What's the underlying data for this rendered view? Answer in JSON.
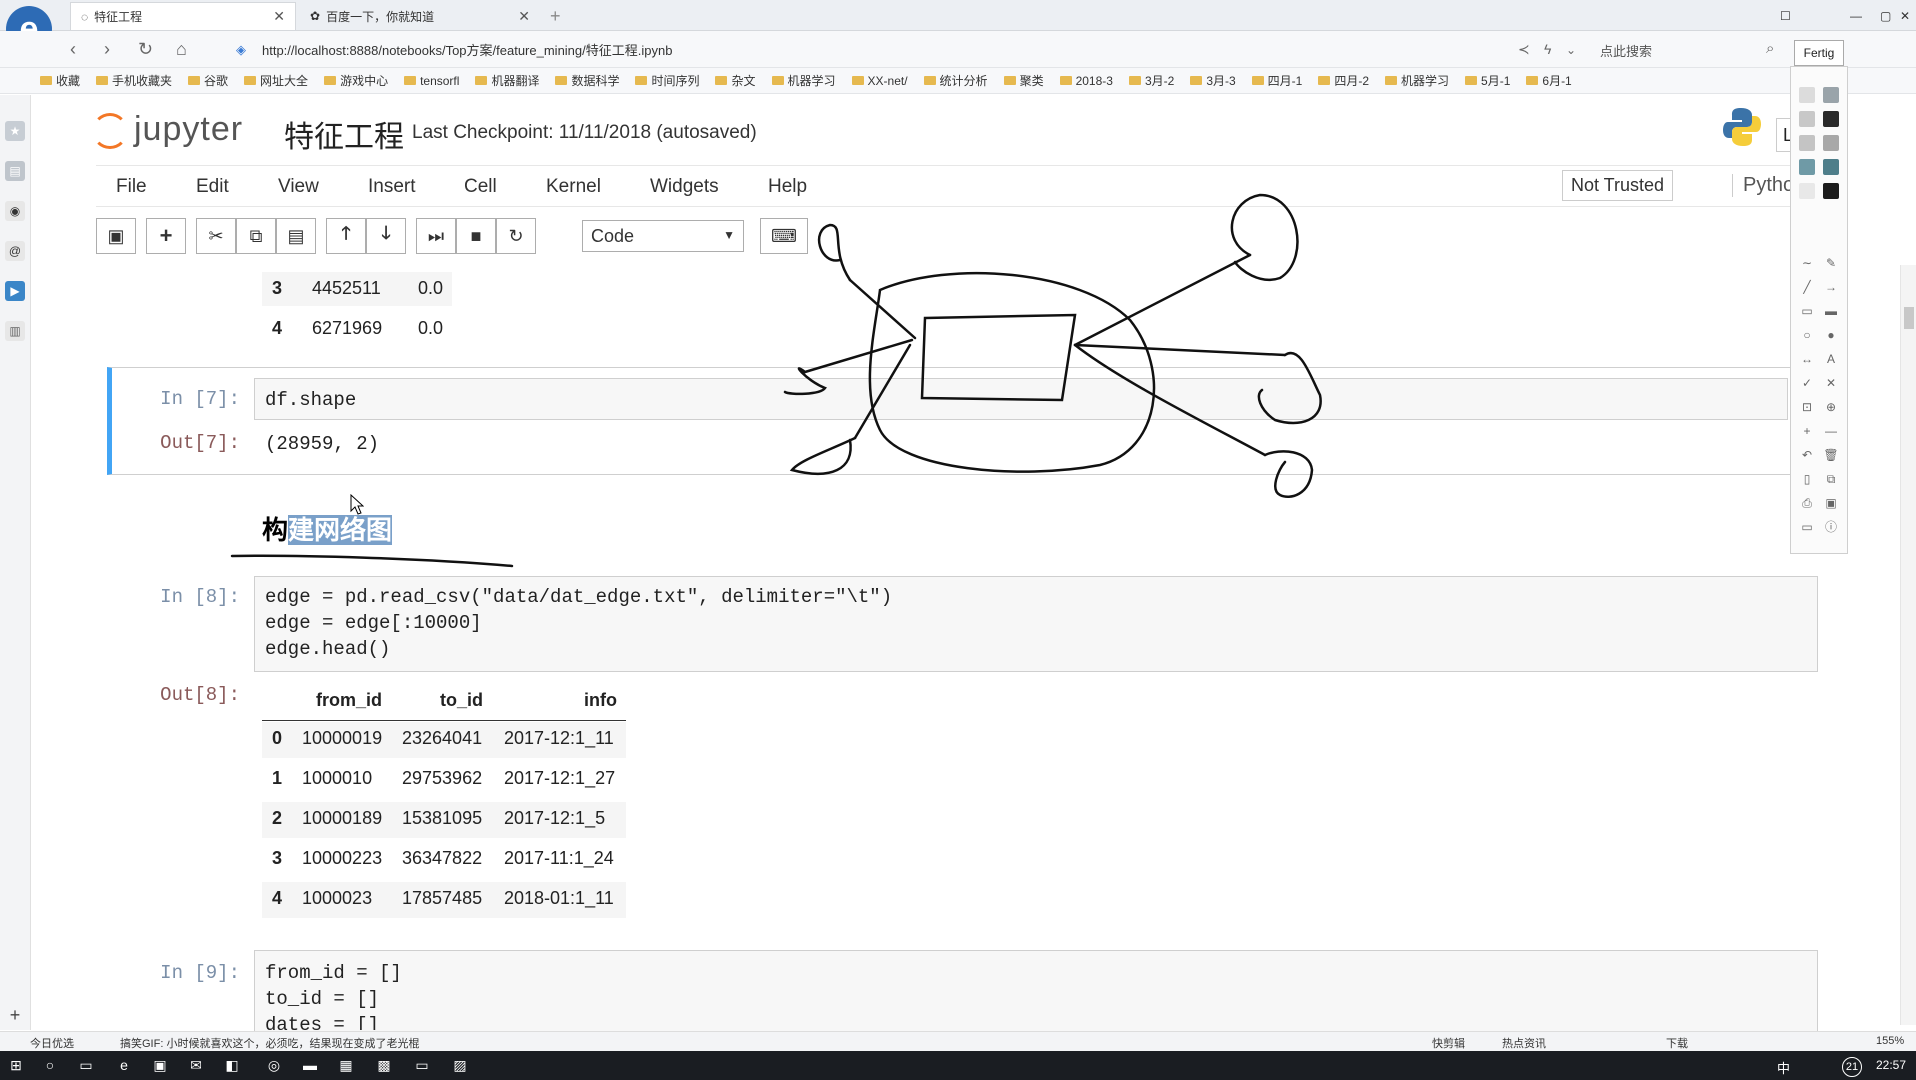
{
  "browser": {
    "tabs": [
      {
        "label": "特征工程",
        "active": true
      },
      {
        "label": "百度一下，你就知道",
        "active": false
      }
    ],
    "url": "http://localhost:8888/notebooks/Top方案/feature_mining/特征工程.ipynb",
    "search_hint": "点此搜索",
    "bookmarks": [
      "收藏",
      "手机收藏夹",
      "谷歌",
      "网址大全",
      "游戏中心",
      "tensorfl",
      "机器翻译",
      "数据科学",
      "时间序列",
      "杂文",
      "机器学习",
      "XX-net/",
      "统计分析",
      "聚类",
      "2018-3",
      "3月-2",
      "3月-3",
      "四月-1",
      "四月-2",
      "机器学习",
      "5月-1",
      "6月-1"
    ]
  },
  "jupyter": {
    "logo_text": "jupyter",
    "notebook_title": "特征工程",
    "checkpoint": "Last Checkpoint: 11/11/2018 (autosaved)",
    "menu": [
      "File",
      "Edit",
      "View",
      "Insert",
      "Cell",
      "Kernel",
      "Widgets",
      "Help"
    ],
    "trusted": "Not Trusted",
    "kernel": "Pytho",
    "cell_type": "Code"
  },
  "top_table_rows": [
    {
      "idx": "3",
      "a": "4452511",
      "b": "0.0"
    },
    {
      "idx": "4",
      "a": "6271969",
      "b": "0.0"
    }
  ],
  "cell7": {
    "prompt_in": "In [7]:",
    "code": "df.shape",
    "prompt_out": "Out[7]:",
    "output": "(28959, 2)"
  },
  "heading": {
    "pre": "构",
    "highlighted": "建网络图"
  },
  "cell8": {
    "prompt_in": "In [8]:",
    "code_lines": [
      "edge = pd.read_csv(\"data/dat_edge.txt\", delimiter=\"\\t\")",
      "edge = edge[:10000]",
      "edge.head()"
    ],
    "prompt_out": "Out[8]:",
    "columns": [
      "from_id",
      "to_id",
      "info"
    ],
    "rows": [
      {
        "idx": "0",
        "from_id": "10000019",
        "to_id": "23264041",
        "info": "2017-12:1_11"
      },
      {
        "idx": "1",
        "from_id": "1000010",
        "to_id": "29753962",
        "info": "2017-12:1_27"
      },
      {
        "idx": "2",
        "from_id": "10000189",
        "to_id": "15381095",
        "info": "2017-12:1_5"
      },
      {
        "idx": "3",
        "from_id": "10000223",
        "to_id": "36347822",
        "info": "2017-11:1_24"
      },
      {
        "idx": "4",
        "from_id": "1000023",
        "to_id": "17857485",
        "info": "2018-01:1_11"
      }
    ]
  },
  "cell9": {
    "prompt_in": "In [9]:",
    "code_lines": [
      "from_id = []",
      "to_id = []",
      "dates = []"
    ]
  },
  "palette": {
    "done_label": "Fertig"
  },
  "statusbar": {
    "left": "今日优选",
    "news": "搞笑GIF: 小时候就喜欢这个，必须吃，结果现在变成了老光棍",
    "right_items": [
      "快剪辑",
      "热点资讯",
      "下载"
    ],
    "zoom": "155%"
  },
  "taskbar": {
    "time": "22:57",
    "lang": "中",
    "notif": "21"
  }
}
